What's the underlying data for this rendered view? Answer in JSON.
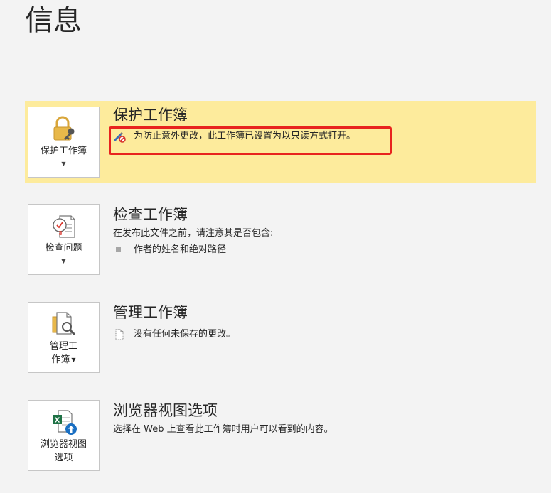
{
  "page": {
    "title": "信息"
  },
  "protect": {
    "button_label": "保护工作簿",
    "title": "保护工作簿",
    "message": "为防止意外更改，此工作簿已设置为以只读方式打开。"
  },
  "inspect": {
    "button_label": "检查问题",
    "title": "检查工作簿",
    "description": "在发布此文件之前，请注意其是否包含:",
    "items": [
      "作者的姓名和绝对路径"
    ]
  },
  "manage": {
    "button_label_line1": "管理工",
    "button_label_line2": "作簿",
    "title": "管理工作簿",
    "message": "没有任何未保存的更改。"
  },
  "browser": {
    "button_label_line1": "浏览器视图",
    "button_label_line2": "选项",
    "title": "浏览器视图选项",
    "description": "选择在 Web 上查看此工作簿时用户可以看到的内容。"
  },
  "colors": {
    "protect_background": "#fdeb9c",
    "highlight_border": "#e8231e",
    "lock_gold": "#e8b84a",
    "excel_green": "#1e7145",
    "upload_blue": "#1a6fc2"
  },
  "icons": {
    "protect": "lock-key-icon",
    "inspect": "document-checklist-icon",
    "manage": "document-search-icon",
    "browser": "excel-upload-icon",
    "readonly": "edit-prohibited-icon",
    "unsaved": "document-small-icon"
  }
}
